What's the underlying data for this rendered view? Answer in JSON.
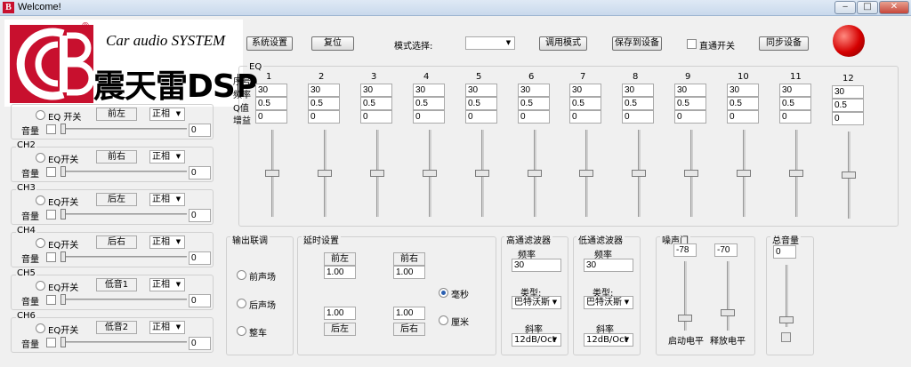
{
  "window": {
    "title": "Welcome!",
    "btn_min": "‒",
    "btn_max": "□",
    "btn_close": "✕"
  },
  "brand": {
    "logo_letter": "B",
    "registered": "®",
    "tagline": "Car audio SYSTEM",
    "product": "震天雷DSP"
  },
  "toolbar": {
    "system_settings": "系统设置",
    "reset": "复位",
    "mode_select_label": "模式选择:",
    "mode_select_value": "",
    "call_mode": "调用模式",
    "save_to_device": "保存到设备",
    "passthrough_label": "直通开关",
    "sync_device": "同步设备"
  },
  "eq": {
    "group_label": "EQ",
    "row_labels": [
      "序号",
      "频率",
      "Q值",
      "增益"
    ],
    "bands": [
      {
        "num": "1",
        "freq": "30",
        "q": "0.5",
        "gain": "0"
      },
      {
        "num": "2",
        "freq": "30",
        "q": "0.5",
        "gain": "0"
      },
      {
        "num": "3",
        "freq": "30",
        "q": "0.5",
        "gain": "0"
      },
      {
        "num": "4",
        "freq": "30",
        "q": "0.5",
        "gain": "0"
      },
      {
        "num": "5",
        "freq": "30",
        "q": "0.5",
        "gain": "0"
      },
      {
        "num": "6",
        "freq": "30",
        "q": "0.5",
        "gain": "0"
      },
      {
        "num": "7",
        "freq": "30",
        "q": "0.5",
        "gain": "0"
      },
      {
        "num": "8",
        "freq": "30",
        "q": "0.5",
        "gain": "0"
      },
      {
        "num": "9",
        "freq": "30",
        "q": "0.5",
        "gain": "0"
      },
      {
        "num": "10",
        "freq": "30",
        "q": "0.5",
        "gain": "0"
      },
      {
        "num": "11",
        "freq": "30",
        "q": "0.5",
        "gain": "0"
      },
      {
        "num": "12",
        "freq": "30",
        "q": "0.5",
        "gain": "0"
      }
    ]
  },
  "channels": [
    {
      "label": "",
      "eq_switch": "EQ 开关",
      "position": "前左",
      "phase": "正相",
      "volume_label": "音量",
      "volume": "0"
    },
    {
      "label": "CH2",
      "eq_switch": "EQ开关",
      "position": "前右",
      "phase": "正相",
      "volume_label": "音量",
      "volume": "0"
    },
    {
      "label": "CH3",
      "eq_switch": "EQ开关",
      "position": "后左",
      "phase": "正相",
      "volume_label": "音量",
      "volume": "0"
    },
    {
      "label": "CH4",
      "eq_switch": "EQ开关",
      "position": "后右",
      "phase": "正相",
      "volume_label": "音量",
      "volume": "0"
    },
    {
      "label": "CH5",
      "eq_switch": "EQ开关",
      "position": "低音1",
      "phase": "正相",
      "volume_label": "音量",
      "volume": "0"
    },
    {
      "label": "CH6",
      "eq_switch": "EQ开关",
      "position": "低音2",
      "phase": "正相",
      "volume_label": "音量",
      "volume": "0"
    }
  ],
  "output_link": {
    "title": "输出联调",
    "front": "前声场",
    "rear": "后声场",
    "whole": "整车"
  },
  "delay": {
    "title": "延时设置",
    "front_left_label": "前左",
    "front_right_label": "前右",
    "front_left": "1.00",
    "front_right": "1.00",
    "rear_left": "1.00",
    "rear_right": "1.00",
    "rear_left_label": "后左",
    "rear_right_label": "后右",
    "unit_ms": "毫秒",
    "unit_cm": "厘米"
  },
  "highpass": {
    "title": "高通滤波器",
    "freq_label": "频率",
    "freq": "30",
    "type_label": "类型:",
    "type": "巴特沃斯",
    "slope_label": "斜率",
    "slope": "12dB/Oct"
  },
  "lowpass": {
    "title": "低通滤波器",
    "freq_label": "频率",
    "freq": "30",
    "type_label": "类型:",
    "type": "巴特沃斯",
    "slope_label": "斜率",
    "slope": "12dB/Oct"
  },
  "noise_gate": {
    "title": "噪声门",
    "start_value": "-78",
    "release_value": "-70",
    "start_label": "启动电平",
    "release_label": "释放电平"
  },
  "master": {
    "title": "总音量",
    "value": "0"
  },
  "colors": {
    "led": "#d50000",
    "logo_red": "#c8102e"
  }
}
